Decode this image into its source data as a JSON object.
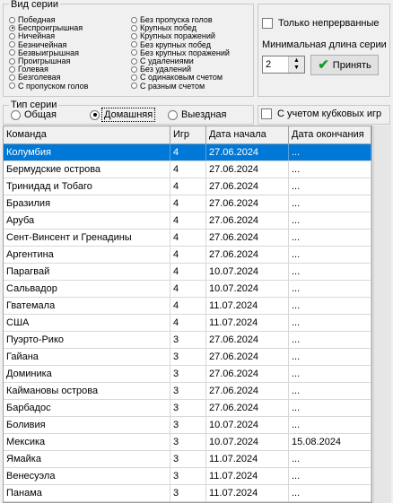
{
  "series_kind": {
    "legend": "Вид серии",
    "left": [
      "Победная",
      "Беспроигрышная",
      "Ничейная",
      "Безничейная",
      "Безвыигрышная",
      "Проигрышная",
      "Голевая",
      "Безголевая",
      "С пропуском голов"
    ],
    "right": [
      "Без пропуска голов",
      "Крупных побед",
      "Крупных поражений",
      "Без крупных побед",
      "Без крупных поражений",
      "С удалениями",
      "Без удалений",
      "С одинаковым счетом",
      "С разным счетом"
    ],
    "selected": "Беспроигрышная"
  },
  "options": {
    "only_continuous": "Только непрерванные",
    "min_length_label": "Минимальная длина серии",
    "min_length_value": "2",
    "accept_label": "Принять",
    "cup_games": "С учетом кубковых игр"
  },
  "series_type": {
    "legend": "Тип серии",
    "items": [
      "Общая",
      "Домашняя",
      "Выездная"
    ],
    "selected": "Домашняя"
  },
  "table": {
    "columns": [
      "Команда",
      "Игр",
      "Дата начала",
      "Дата окончания"
    ],
    "rows": [
      [
        "Колумбия",
        "4",
        "27.06.2024",
        "..."
      ],
      [
        "Бермудские острова",
        "4",
        "27.06.2024",
        "..."
      ],
      [
        "Тринидад и Тобаго",
        "4",
        "27.06.2024",
        "..."
      ],
      [
        "Бразилия",
        "4",
        "27.06.2024",
        "..."
      ],
      [
        "Аруба",
        "4",
        "27.06.2024",
        "..."
      ],
      [
        "Сент-Винсент и Гренадины",
        "4",
        "27.06.2024",
        "..."
      ],
      [
        "Аргентина",
        "4",
        "27.06.2024",
        "..."
      ],
      [
        "Парагвай",
        "4",
        "10.07.2024",
        "..."
      ],
      [
        "Сальвадор",
        "4",
        "10.07.2024",
        "..."
      ],
      [
        "Гватемала",
        "4",
        "11.07.2024",
        "..."
      ],
      [
        "США",
        "4",
        "11.07.2024",
        "..."
      ],
      [
        "Пуэрто-Рико",
        "3",
        "27.06.2024",
        "..."
      ],
      [
        "Гайана",
        "3",
        "27.06.2024",
        "..."
      ],
      [
        "Доминика",
        "3",
        "27.06.2024",
        "..."
      ],
      [
        "Каймановы острова",
        "3",
        "27.06.2024",
        "..."
      ],
      [
        "Барбадос",
        "3",
        "27.06.2024",
        "..."
      ],
      [
        "Боливия",
        "3",
        "10.07.2024",
        "..."
      ],
      [
        "Мексика",
        "3",
        "10.07.2024",
        "15.08.2024"
      ],
      [
        "Ямайка",
        "3",
        "11.07.2024",
        "..."
      ],
      [
        "Венесуэла",
        "3",
        "11.07.2024",
        "..."
      ],
      [
        "Панама",
        "3",
        "11.07.2024",
        "..."
      ]
    ],
    "selected_row": 0
  }
}
